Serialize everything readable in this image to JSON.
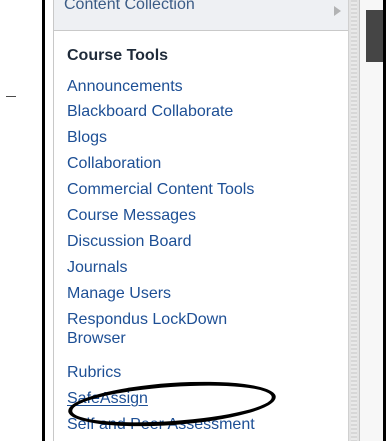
{
  "course_menu": {
    "cut_header": "Content Collection",
    "section_title": "Course Tools",
    "items": [
      "Announcements",
      "Blackboard Collaborate",
      "Blogs",
      "Collaboration",
      "Commercial Content Tools",
      "Course Messages",
      "Discussion Board",
      "Journals",
      "Manage Users",
      "Respondus LockDown",
      "Browser",
      "Rubrics",
      "SafeAssign",
      "Self and Peer Assessment"
    ]
  },
  "colors": {
    "link": "#1d4f95",
    "title": "#1f2b3a",
    "border": "#000000"
  }
}
